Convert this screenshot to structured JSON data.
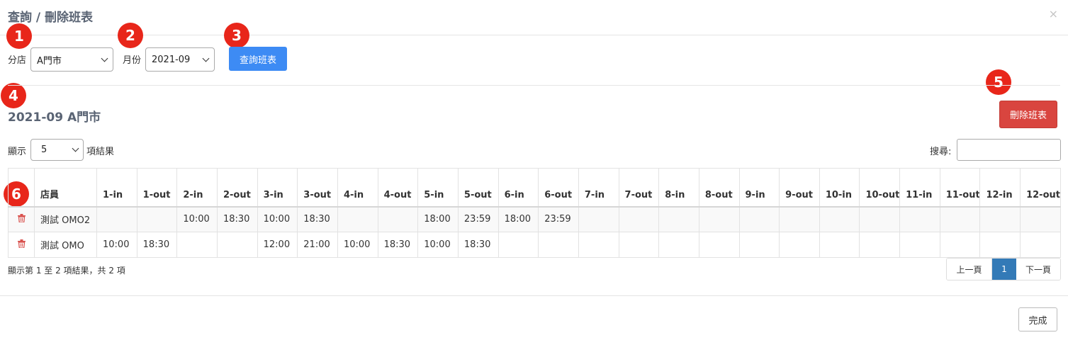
{
  "modal": {
    "title": "查詢 / 刪除班表",
    "close": "×",
    "done_label": "完成"
  },
  "filters": {
    "store_label": "分店",
    "store_value": "A門市",
    "month_label": "月份",
    "month_value": "2021-09",
    "query_label": "查詢班表"
  },
  "schedule": {
    "title": "2021-09 A門市",
    "delete_label": "刪除班表"
  },
  "length_menu": {
    "prefix": "顯示",
    "value": "5",
    "suffix": "項結果"
  },
  "search": {
    "label": "搜尋:",
    "value": ""
  },
  "badges": [
    "1",
    "2",
    "3",
    "4",
    "5",
    "6"
  ],
  "table": {
    "headers": [
      "",
      "店員",
      "1-in",
      "1-out",
      "2-in",
      "2-out",
      "3-in",
      "3-out",
      "4-in",
      "4-out",
      "5-in",
      "5-out",
      "6-in",
      "6-out",
      "7-in",
      "7-out",
      "8-in",
      "8-out",
      "9-in",
      "9-out",
      "10-in",
      "10-out",
      "11-in",
      "11-out",
      "12-in",
      "12-out"
    ],
    "rows": [
      {
        "name": "測試 OMO2",
        "times": [
          "",
          "",
          "10:00",
          "18:30",
          "10:00",
          "18:30",
          "",
          "",
          "18:00",
          "23:59",
          "18:00",
          "23:59",
          "",
          "",
          "",
          "",
          "",
          "",
          "",
          "",
          "",
          "",
          "",
          ""
        ]
      },
      {
        "name": "測試 OMO",
        "times": [
          "10:00",
          "18:30",
          "",
          "",
          "12:00",
          "21:00",
          "10:00",
          "18:30",
          "10:00",
          "18:30",
          "",
          "",
          "",
          "",
          "",
          "",
          "",
          "",
          "",
          "",
          "",
          "",
          "",
          ""
        ]
      }
    ],
    "row_icon": "trash-icon"
  },
  "info_text": "顯示第 1 至 2 項結果，共 2 項",
  "pagination": {
    "prev": "上一頁",
    "current": "1",
    "next": "下一頁"
  },
  "colors": {
    "primary": "#3d8bf4",
    "danger": "#d9453f",
    "badge": "#e8261a",
    "page_active": "#337ab7"
  }
}
